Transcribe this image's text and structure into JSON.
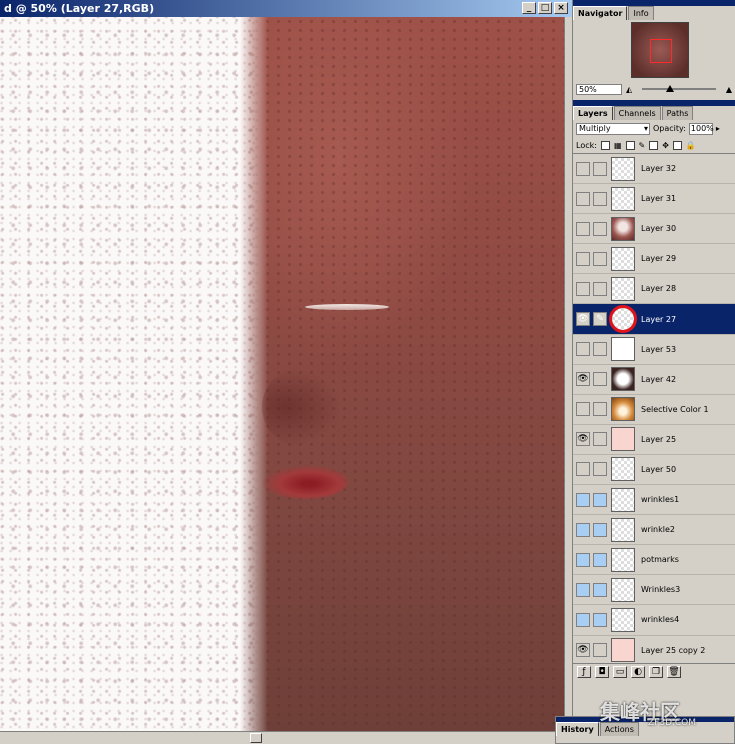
{
  "document": {
    "title": "d @ 50% (Layer 27,RGB)",
    "buttons": [
      "_",
      "□",
      "×"
    ]
  },
  "navigator": {
    "tabs": [
      "Navigator",
      "Info"
    ],
    "zoom": "50%"
  },
  "layers_panel": {
    "tabs": [
      "Layers",
      "Channels",
      "Paths"
    ],
    "blend_mode": "Multiply",
    "opacity_label": "Opacity:",
    "opacity_value": "100%",
    "lock_label": "Lock:",
    "layers": [
      {
        "name": "Layer 32",
        "visible": false,
        "thumb": "checker"
      },
      {
        "name": "Layer 31",
        "visible": false,
        "thumb": "checker"
      },
      {
        "name": "Layer 30",
        "visible": false,
        "thumb": "face"
      },
      {
        "name": "Layer 29",
        "visible": false,
        "thumb": "checker"
      },
      {
        "name": "Layer 28",
        "visible": false,
        "thumb": "checker"
      },
      {
        "name": "Layer 27",
        "visible": true,
        "thumb": "checker",
        "selected": true
      },
      {
        "name": "Layer 53",
        "visible": false,
        "thumb": "white"
      },
      {
        "name": "Layer 42",
        "visible": true,
        "thumb": "dark"
      },
      {
        "name": "Selective Color 1",
        "visible": false,
        "thumb": "gold"
      },
      {
        "name": "Layer 25",
        "visible": true,
        "thumb": "pink"
      },
      {
        "name": "Layer 50",
        "visible": false,
        "thumb": "checker"
      },
      {
        "name": "wrinkles1",
        "visible": false,
        "thumb": "checker",
        "group": true
      },
      {
        "name": "wrinkle2",
        "visible": false,
        "thumb": "checker",
        "group": true
      },
      {
        "name": "potmarks",
        "visible": false,
        "thumb": "checker",
        "group": true
      },
      {
        "name": "Wrinkles3",
        "visible": false,
        "thumb": "checker",
        "group": true
      },
      {
        "name": "wrinkles4",
        "visible": false,
        "thumb": "checker",
        "group": true
      },
      {
        "name": "Layer 25 copy 2",
        "visible": true,
        "thumb": "pink"
      }
    ]
  },
  "history": {
    "tabs": [
      "History",
      "Actions"
    ]
  },
  "watermark": {
    "main": "集峰社区",
    "sub": "ZF3D.COM"
  },
  "colors": {
    "selection": "#0a246a",
    "highlight_ring": "#e0141a"
  }
}
